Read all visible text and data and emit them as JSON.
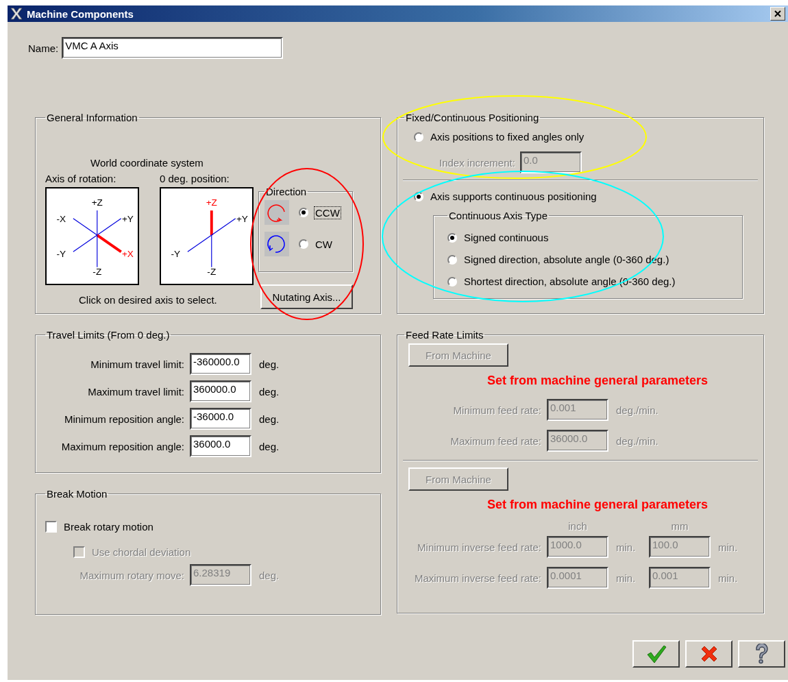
{
  "window": {
    "title": "Machine Components"
  },
  "name_field": {
    "label": "Name:",
    "value": "VMC A Axis"
  },
  "general_information": {
    "title": "General Information",
    "caption": "World coordinate system",
    "diagrams": [
      {
        "label": "Axis of rotation:",
        "axes": [
          {
            "text": "+Z",
            "kind": "top",
            "selected": false
          },
          {
            "text": "-X",
            "kind": "upper_left",
            "selected": false
          },
          {
            "text": "+Y",
            "kind": "upper_right",
            "selected": false
          },
          {
            "text": "-Y",
            "kind": "lower_left",
            "selected": false
          },
          {
            "text": "+X",
            "kind": "lower_right",
            "selected": true
          },
          {
            "text": "-Z",
            "kind": "bottom",
            "selected": false
          }
        ]
      },
      {
        "label": "0 deg. position:",
        "axes": [
          {
            "text": "+Z",
            "kind": "top",
            "selected": true
          },
          {
            "text": "+Y",
            "kind": "upper_right",
            "selected": false
          },
          {
            "text": "-Y",
            "kind": "lower_left",
            "selected": false
          },
          {
            "text": "-Z",
            "kind": "bottom",
            "selected": false
          }
        ]
      }
    ],
    "hint": "Click on desired axis to select.",
    "direction": {
      "title": "Direction",
      "options": [
        {
          "label": "CCW",
          "kind": "ccw",
          "selected": true,
          "focused": true
        },
        {
          "label": "CW",
          "kind": "cw",
          "selected": false,
          "focused": false
        }
      ]
    },
    "nutating_button": "Nutating Axis..."
  },
  "positioning": {
    "title": "Fixed/Continuous Positioning",
    "fixed_mode": {
      "label": "Axis positions to fixed angles only",
      "selected": false
    },
    "index_increment": {
      "label": "Index increment:",
      "value": "0.0",
      "disabled": true
    },
    "continuous_mode": {
      "label": "Axis supports continuous positioning",
      "selected": true
    },
    "continuous_axis_type": {
      "title": "Continuous Axis Type",
      "options": [
        {
          "label": "Signed continuous",
          "selected": true
        },
        {
          "label": "Signed direction, absolute angle (0-360 deg.)",
          "selected": false
        },
        {
          "label": "Shortest direction, absolute angle (0-360 deg.)",
          "selected": false
        }
      ]
    }
  },
  "travel_limits": {
    "title": "Travel Limits (From 0 deg.)",
    "rows": [
      {
        "label": "Minimum travel limit:",
        "value": "-360000.0",
        "unit": "deg."
      },
      {
        "label": "Maximum travel limit:",
        "value": "360000.0",
        "unit": "deg."
      },
      {
        "label": "Minimum reposition angle:",
        "value": "-36000.0",
        "unit": "deg."
      },
      {
        "label": "Maximum reposition angle:",
        "value": "36000.0",
        "unit": "deg."
      }
    ]
  },
  "break_motion": {
    "title": "Break Motion",
    "break_rotary": {
      "label": "Break rotary motion",
      "checked": false,
      "disabled": false
    },
    "chordal": {
      "label": "Use chordal deviation",
      "checked": false,
      "disabled": true
    },
    "max_rotary": {
      "label": "Maximum rotary move:",
      "value": "6.28319",
      "unit": "deg.",
      "disabled": true
    }
  },
  "feed_rate_limits": {
    "title": "Feed Rate Limits",
    "sections": [
      {
        "button": {
          "label": "From Machine",
          "disabled": true
        },
        "notice": "Set from machine general parameters",
        "rows": [
          {
            "label": "Minimum feed rate:",
            "disabled": true,
            "fields": [
              {
                "value": "0.001",
                "unit": "deg./min."
              }
            ]
          },
          {
            "label": "Maximum feed rate:",
            "disabled": true,
            "fields": [
              {
                "value": "36000.0",
                "unit": "deg./min."
              }
            ]
          }
        ]
      },
      {
        "button": {
          "label": "From Machine",
          "disabled": true
        },
        "notice": "Set from machine general parameters",
        "columns": [
          "inch",
          "mm"
        ],
        "rows": [
          {
            "label": "Minimum inverse feed rate:",
            "disabled": true,
            "fields": [
              {
                "value": "1000.0",
                "unit": "min."
              },
              {
                "value": "100.0",
                "unit": "min."
              }
            ]
          },
          {
            "label": "Maximum inverse feed rate:",
            "disabled": true,
            "fields": [
              {
                "value": "0.0001",
                "unit": "min."
              },
              {
                "value": "0.001",
                "unit": "min."
              }
            ]
          }
        ]
      }
    ]
  },
  "buttons": [
    {
      "kind": "ok"
    },
    {
      "kind": "cancel"
    },
    {
      "kind": "help"
    }
  ],
  "annotations": [
    {
      "kind": "direction",
      "color": "#ff0000"
    },
    {
      "kind": "fixed",
      "color": "#ffff00"
    },
    {
      "kind": "continuous",
      "color": "#00ffff"
    }
  ]
}
